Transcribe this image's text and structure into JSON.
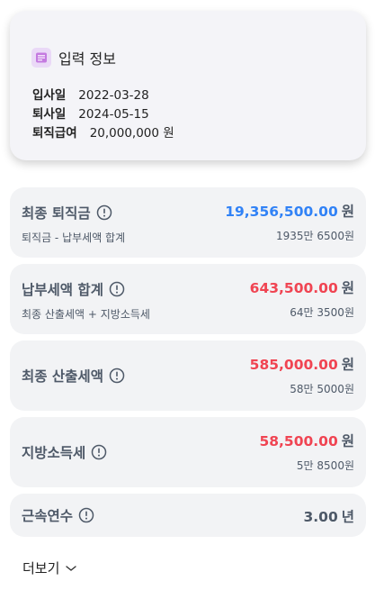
{
  "input_info": {
    "title": "입력 정보",
    "icon": "form-icon",
    "rows": [
      {
        "label": "입사일",
        "value": "2022-03-28"
      },
      {
        "label": "퇴사일",
        "value": "2024-05-15"
      },
      {
        "label": "퇴직급여",
        "value": "20,000,000 원"
      }
    ]
  },
  "results": [
    {
      "title": "최종 퇴직금",
      "subtitle": "퇴직금 - 납부세액 합계",
      "amount": "19,356,500.00",
      "unit": "원",
      "amount_sub": "1935만 6500원",
      "color": "#3182f6"
    },
    {
      "title": "납부세액 합계",
      "subtitle": "최종 산출세액 + 지방소득세",
      "amount": "643,500.00",
      "unit": "원",
      "amount_sub": "64만 3500원",
      "color": "#f04452"
    },
    {
      "title": "최종 산출세액",
      "subtitle": "",
      "amount": "585,000.00",
      "unit": "원",
      "amount_sub": "58만 5000원",
      "color": "#f04452"
    },
    {
      "title": "지방소득세",
      "subtitle": "",
      "amount": "58,500.00",
      "unit": "원",
      "amount_sub": "5만 8500원",
      "color": "#f04452"
    },
    {
      "title": "근속연수",
      "subtitle": "",
      "amount": "3.00",
      "unit": "년",
      "amount_sub": "",
      "color": "#4e5968"
    }
  ],
  "more": {
    "label": "더보기",
    "icon": "chevron-down-icon"
  }
}
